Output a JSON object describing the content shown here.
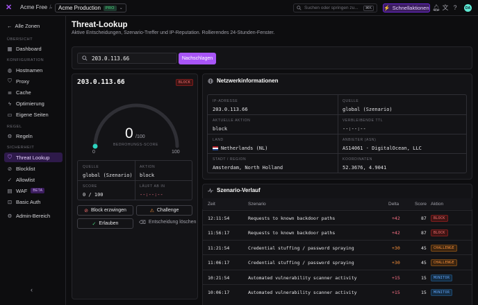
{
  "topbar": {
    "org": "Acme Free",
    "zone": "Acme Production",
    "zone_badge": "PRO",
    "search_placeholder": "Suchen oder springen zu...",
    "search_kbd": "⌘K",
    "quick_actions": "Schnellaktionen",
    "avatar": "DA"
  },
  "sidebar": {
    "back": "Alle Zonen",
    "sections": [
      {
        "label": "ÜBERSICHT",
        "items": [
          {
            "label": "Dashboard",
            "icon": "grid-icon"
          }
        ]
      },
      {
        "label": "KONFIGURATION",
        "items": [
          {
            "label": "Hostnamen",
            "icon": "globe-icon"
          },
          {
            "label": "Proxy",
            "icon": "shield-icon"
          },
          {
            "label": "Cache",
            "icon": "database-icon"
          },
          {
            "label": "Optimierung",
            "icon": "bolt-icon"
          },
          {
            "label": "Eigene Seiten",
            "icon": "file-icon"
          }
        ]
      },
      {
        "label": "REGEL",
        "items": [
          {
            "label": "Regeln",
            "icon": "rules-icon"
          }
        ]
      },
      {
        "label": "SICHERHEIT",
        "items": [
          {
            "label": "Threat Lookup",
            "icon": "shield-search-icon",
            "active": true
          },
          {
            "label": "Blocklist",
            "icon": "ban-icon"
          },
          {
            "label": "Allowlist",
            "icon": "check-circle-icon"
          },
          {
            "label": "WAF",
            "icon": "firewall-icon",
            "badge": "BETA"
          },
          {
            "label": "Basic Auth",
            "icon": "lock-icon"
          },
          {
            "label": "Admin-Bereich",
            "icon": "admin-icon"
          }
        ]
      }
    ]
  },
  "header": {
    "title": "Threat-Lookup",
    "subtitle": "Aktive Entscheidungen, Szenario-Treffer und IP-Reputation. Rollierendes 24-Stunden-Fenster."
  },
  "lookup": {
    "value": "203.0.113.66",
    "button": "Nachschlagen"
  },
  "summary": {
    "ip": "203.0.113.66",
    "badge": "BLOCK",
    "score": "0",
    "score_max": "/100",
    "score_fraction": 0,
    "score_label": "BEDROHUNGS-SCORE",
    "gauge_min": "0",
    "gauge_max": "100",
    "fields": {
      "source_label": "QUELLE",
      "source": "global (Szenario)",
      "action_label": "AKTION",
      "action": "block",
      "score_label": "SCORE",
      "score": "0 / 100",
      "expires_label": "LÄUFT AB IN",
      "expires": "--:--:--"
    },
    "buttons": {
      "force_block": "Block erzwingen",
      "challenge": "Challenge",
      "allow": "Erlauben",
      "delete": "Entscheidung löschen"
    }
  },
  "network": {
    "title": "Netzwerkinformationen",
    "fields": [
      {
        "label": "IP-ADRESSE",
        "value": "203.0.113.66"
      },
      {
        "label": "QUELLE",
        "value": "global (Szenario)"
      },
      {
        "label": "AKTUELLE AKTION",
        "value": "block"
      },
      {
        "label": "VERBLEIBENDE TTL",
        "value": "--:--:--"
      },
      {
        "label": "LAND",
        "value": "Netherlands (NL)"
      },
      {
        "label": "ANBIETER (ASN)",
        "value": "AS14061 · DigitalOcean, LLC"
      },
      {
        "label": "STADT / REGION",
        "value": "Amsterdam, North Holland"
      },
      {
        "label": "KOORDINATEN",
        "value": "52.3676, 4.9041"
      }
    ]
  },
  "history": {
    "title": "Szenario-Verlauf",
    "columns": {
      "time": "Zeit",
      "scenario": "Szenario",
      "delta": "Delta",
      "score": "Score",
      "action": "Aktion"
    },
    "rows": [
      {
        "time": "12:11:54",
        "scenario": "Requests to known backdoor paths",
        "delta": "+42",
        "score": "87",
        "action": "BLOCK"
      },
      {
        "time": "11:56:17",
        "scenario": "Requests to known backdoor paths",
        "delta": "+42",
        "score": "87",
        "action": "BLOCK"
      },
      {
        "time": "11:21:54",
        "scenario": "Credential stuffing / password spraying",
        "delta": "+30",
        "score": "45",
        "action": "CHALLENGE"
      },
      {
        "time": "11:06:17",
        "scenario": "Credential stuffing / password spraying",
        "delta": "+30",
        "score": "45",
        "action": "CHALLENGE"
      },
      {
        "time": "10:21:54",
        "scenario": "Automated vulnerability scanner activity",
        "delta": "+15",
        "score": "15",
        "action": "MONITOR"
      },
      {
        "time": "10:06:17",
        "scenario": "Automated vulnerability scanner activity",
        "delta": "+15",
        "score": "15",
        "action": "MONITOR"
      }
    ]
  }
}
